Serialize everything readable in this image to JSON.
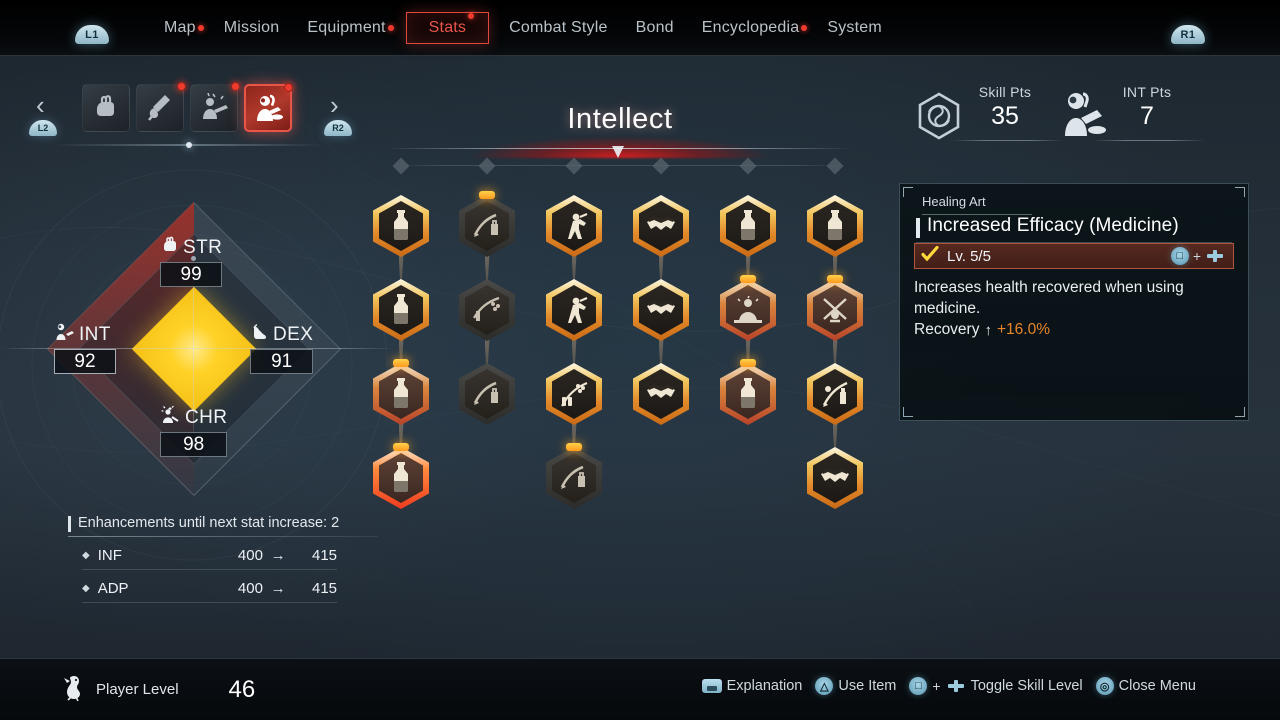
{
  "topnav": {
    "left_bumper": "L1",
    "right_bumper": "R1",
    "items": [
      {
        "label": "Map",
        "active": false,
        "badge": true
      },
      {
        "label": "Mission",
        "active": false,
        "badge": false
      },
      {
        "label": "Equipment",
        "active": false,
        "badge": true
      },
      {
        "label": "Stats",
        "active": true,
        "badge": true
      },
      {
        "label": "Combat Style",
        "active": false,
        "badge": false
      },
      {
        "label": "Bond",
        "active": false,
        "badge": false
      },
      {
        "label": "Encyclopedia",
        "active": false,
        "badge": true
      },
      {
        "label": "System",
        "active": false,
        "badge": false
      }
    ]
  },
  "classbar": {
    "prev_trigger": "L2",
    "next_trigger": "R2",
    "prev_arrow": "‹",
    "next_arrow": "›",
    "tabs": [
      {
        "name": "fist-class",
        "icon": "fist-icon",
        "selected": false,
        "badge": false
      },
      {
        "name": "blade-class",
        "icon": "dagger-icon",
        "selected": false,
        "badge": true
      },
      {
        "name": "gunner-class",
        "icon": "rifle-icon",
        "selected": false,
        "badge": true
      },
      {
        "name": "intellect-class",
        "icon": "scholar-icon",
        "selected": true,
        "badge": true
      }
    ]
  },
  "tree": {
    "title": "Intellect",
    "column_markers": 6,
    "nodes": [
      {
        "id": "n-c1-r1",
        "col": 1,
        "row": 1,
        "state": "max",
        "icon": "potion-icon",
        "selected": false,
        "link_down": true
      },
      {
        "id": "n-c1-r2",
        "col": 1,
        "row": 2,
        "state": "max",
        "icon": "potion-icon",
        "selected": false,
        "link_down": true
      },
      {
        "id": "n-c1-r3",
        "col": 1,
        "row": 3,
        "state": "part",
        "icon": "potion-icon",
        "selected": false,
        "link_down": true
      },
      {
        "id": "n-c1-r4",
        "col": 1,
        "row": 4,
        "state": "part",
        "icon": "potion-icon",
        "selected": true,
        "link_down": false
      },
      {
        "id": "n-c2-r1",
        "col": 2,
        "row": 1,
        "state": "lock",
        "icon": "blade-bag-icon",
        "selected": false,
        "link_down": true
      },
      {
        "id": "n-c2-r2",
        "col": 2,
        "row": 2,
        "state": "lock",
        "icon": "blade-dots-icon",
        "selected": false,
        "link_down": true
      },
      {
        "id": "n-c2-r3",
        "col": 2,
        "row": 3,
        "state": "lock",
        "icon": "blade-bag-icon",
        "selected": false,
        "link_down": false
      },
      {
        "id": "n-c3-r1",
        "col": 3,
        "row": 1,
        "state": "max",
        "icon": "pose-icon",
        "selected": false,
        "link_down": true
      },
      {
        "id": "n-c3-r2",
        "col": 3,
        "row": 2,
        "state": "max",
        "icon": "pose-icon",
        "selected": false,
        "link_down": true
      },
      {
        "id": "n-c3-r3",
        "col": 3,
        "row": 3,
        "state": "max",
        "icon": "tools-icon",
        "selected": false,
        "link_down": true
      },
      {
        "id": "n-c3-r4",
        "col": 3,
        "row": 4,
        "state": "lock",
        "icon": "blade-bag-icon",
        "selected": false,
        "link_down": false
      },
      {
        "id": "n-c4-r1",
        "col": 4,
        "row": 1,
        "state": "max",
        "icon": "handshake-icon",
        "selected": false,
        "link_down": true
      },
      {
        "id": "n-c4-r2",
        "col": 4,
        "row": 2,
        "state": "max",
        "icon": "handshake-icon",
        "selected": false,
        "link_down": true
      },
      {
        "id": "n-c4-r3",
        "col": 4,
        "row": 3,
        "state": "max",
        "icon": "handshake-icon",
        "selected": false,
        "link_down": false
      },
      {
        "id": "n-c5-r1",
        "col": 5,
        "row": 1,
        "state": "max",
        "icon": "potion-icon",
        "selected": false,
        "link_down": true
      },
      {
        "id": "n-c5-r2",
        "col": 5,
        "row": 2,
        "state": "part",
        "icon": "scholar2-icon",
        "selected": false,
        "link_down": true
      },
      {
        "id": "n-c5-r3",
        "col": 5,
        "row": 3,
        "state": "part",
        "icon": "potion-icon",
        "selected": false,
        "link_down": false
      },
      {
        "id": "n-c6-r1",
        "col": 6,
        "row": 1,
        "state": "max",
        "icon": "potion-icon",
        "selected": false,
        "link_down": true
      },
      {
        "id": "n-c6-r2",
        "col": 6,
        "row": 2,
        "state": "part",
        "icon": "crossed-icon",
        "selected": false,
        "link_down": true
      },
      {
        "id": "n-c6-r3",
        "col": 6,
        "row": 3,
        "state": "max",
        "icon": "sword-flask-icon",
        "selected": false,
        "link_down": true
      },
      {
        "id": "n-c6-r4",
        "col": 6,
        "row": 4,
        "state": "max",
        "icon": "handshake-icon",
        "selected": false,
        "link_down": false
      }
    ]
  },
  "points": {
    "skill_label": "Skill Pts",
    "skill_value": "35",
    "int_label": "INT Pts",
    "int_value": "7"
  },
  "skill_panel": {
    "category": "Healing Art",
    "title": "Increased Efficacy (Medicine)",
    "level": "Lv. 5/5",
    "description": "Increases health recovered when using medicine.",
    "stat_label": "Recovery",
    "stat_arrow": "↑",
    "stat_value": "+16.0%",
    "hint_plus": "+"
  },
  "stats": {
    "str": {
      "label": "STR",
      "value": "99",
      "icon": "fist-icon"
    },
    "dex": {
      "label": "DEX",
      "value": "91",
      "icon": "boot-icon"
    },
    "int": {
      "label": "INT",
      "value": "92",
      "icon": "scholar-icon"
    },
    "chr": {
      "label": "CHR",
      "value": "98",
      "icon": "craft-icon"
    }
  },
  "enhancements": {
    "header": "Enhancements until next stat increase:",
    "header_count": "2",
    "arrow": "→",
    "rows": [
      {
        "label": "INF",
        "from": "400",
        "to": "415"
      },
      {
        "label": "ADP",
        "from": "400",
        "to": "415"
      }
    ]
  },
  "bottombar": {
    "player_level_label": "Player Level",
    "player_level_value": "46",
    "hints": [
      {
        "glyph": "touchpad",
        "label": "Explanation"
      },
      {
        "glyph": "triangle",
        "label": "Use Item"
      },
      {
        "glyph": "square-dpad",
        "label": "Toggle Skill Level"
      },
      {
        "glyph": "circle",
        "label": "Close Menu"
      }
    ],
    "plus": "+"
  },
  "colors": {
    "accent_red": "#e8564a",
    "gold": "#f2c45a",
    "orange": "#e8862a",
    "panel_bg": "#0a1418",
    "bg": "#27323d"
  }
}
